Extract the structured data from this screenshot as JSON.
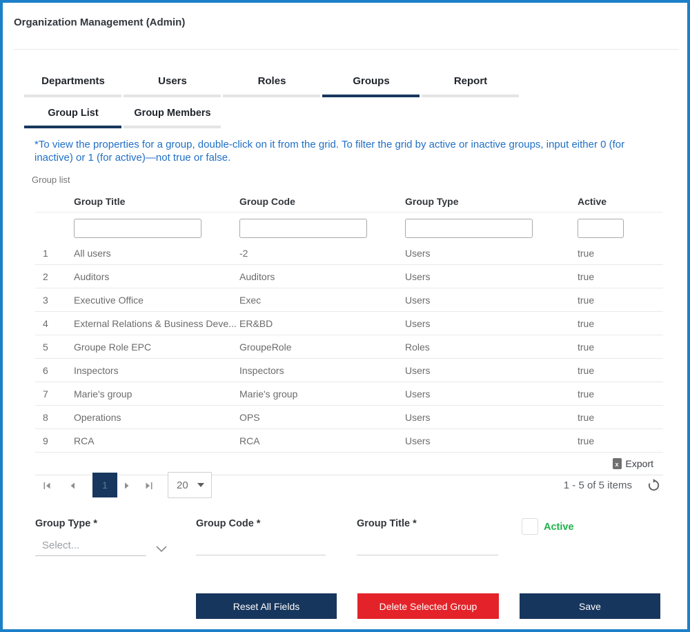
{
  "colors": {
    "frame_blue": "#1b80c8",
    "navy": "#17375e",
    "link_blue": "#1f6fc5",
    "danger_red": "#e32329",
    "success_green": "#1fb24c"
  },
  "page": {
    "title": "Organization Management (Admin)"
  },
  "tabs": [
    {
      "label": "Departments"
    },
    {
      "label": "Users"
    },
    {
      "label": "Roles"
    },
    {
      "label": "Groups"
    },
    {
      "label": "Report"
    }
  ],
  "active_tab": "Groups",
  "subtabs": [
    {
      "label": "Group List"
    },
    {
      "label": "Group Members"
    }
  ],
  "active_subtab": "Group List",
  "note": "*To view the properties for a group, double-click on it from the grid. To filter the grid by active or inactive groups, input either 0 (for inactive) or 1 (for active)—not true or false.",
  "grid": {
    "caption": "Group list",
    "columns": [
      "Group Title",
      "Group Code",
      "Group Type",
      "Active"
    ],
    "filter_values": {
      "group_title": "",
      "group_code": "",
      "group_type": "",
      "active": ""
    },
    "rows": [
      {
        "num": "1",
        "title": "All users",
        "code": "-2",
        "type": "Users",
        "active": "true"
      },
      {
        "num": "2",
        "title": "Auditors",
        "code": "Auditors",
        "type": "Users",
        "active": "true"
      },
      {
        "num": "3",
        "title": "Executive Office",
        "code": "Exec",
        "type": "Users",
        "active": "true"
      },
      {
        "num": "4",
        "title": "External Relations & Business Deve...",
        "code": "ER&BD",
        "type": "Users",
        "active": "true"
      },
      {
        "num": "5",
        "title": "Groupe Role EPC",
        "code": "GroupeRole",
        "type": "Roles",
        "active": "true"
      },
      {
        "num": "6",
        "title": "Inspectors",
        "code": "Inspectors",
        "type": "Users",
        "active": "true"
      },
      {
        "num": "7",
        "title": "Marie's group",
        "code": "Marie's group",
        "type": "Users",
        "active": "true"
      },
      {
        "num": "8",
        "title": "Operations",
        "code": "OPS",
        "type": "Users",
        "active": "true"
      },
      {
        "num": "9",
        "title": "RCA",
        "code": "RCA",
        "type": "Users",
        "active": "true"
      }
    ],
    "export_label": "Export",
    "pager": {
      "current_page": "1",
      "page_size": "20",
      "items_text": "1 - 5 of 5 items"
    }
  },
  "form": {
    "group_type_label": "Group Type *",
    "group_type_placeholder": "Select...",
    "group_code_label": "Group Code *",
    "group_code_value": "",
    "group_title_label": "Group Title *",
    "group_title_value": "",
    "active_label": "Active",
    "active_checked": false
  },
  "actions": {
    "reset": "Reset All Fields",
    "delete": "Delete Selected Group",
    "save": "Save"
  },
  "icons": {
    "excel_export": "excel-export-icon",
    "refresh": "refresh-icon",
    "first_page": "first-page-icon",
    "prev_page": "prev-page-icon",
    "next_page": "next-page-icon",
    "last_page": "last-page-icon",
    "dropdown_caret": "caret-down-icon",
    "select_chevron": "chevron-down-icon"
  }
}
